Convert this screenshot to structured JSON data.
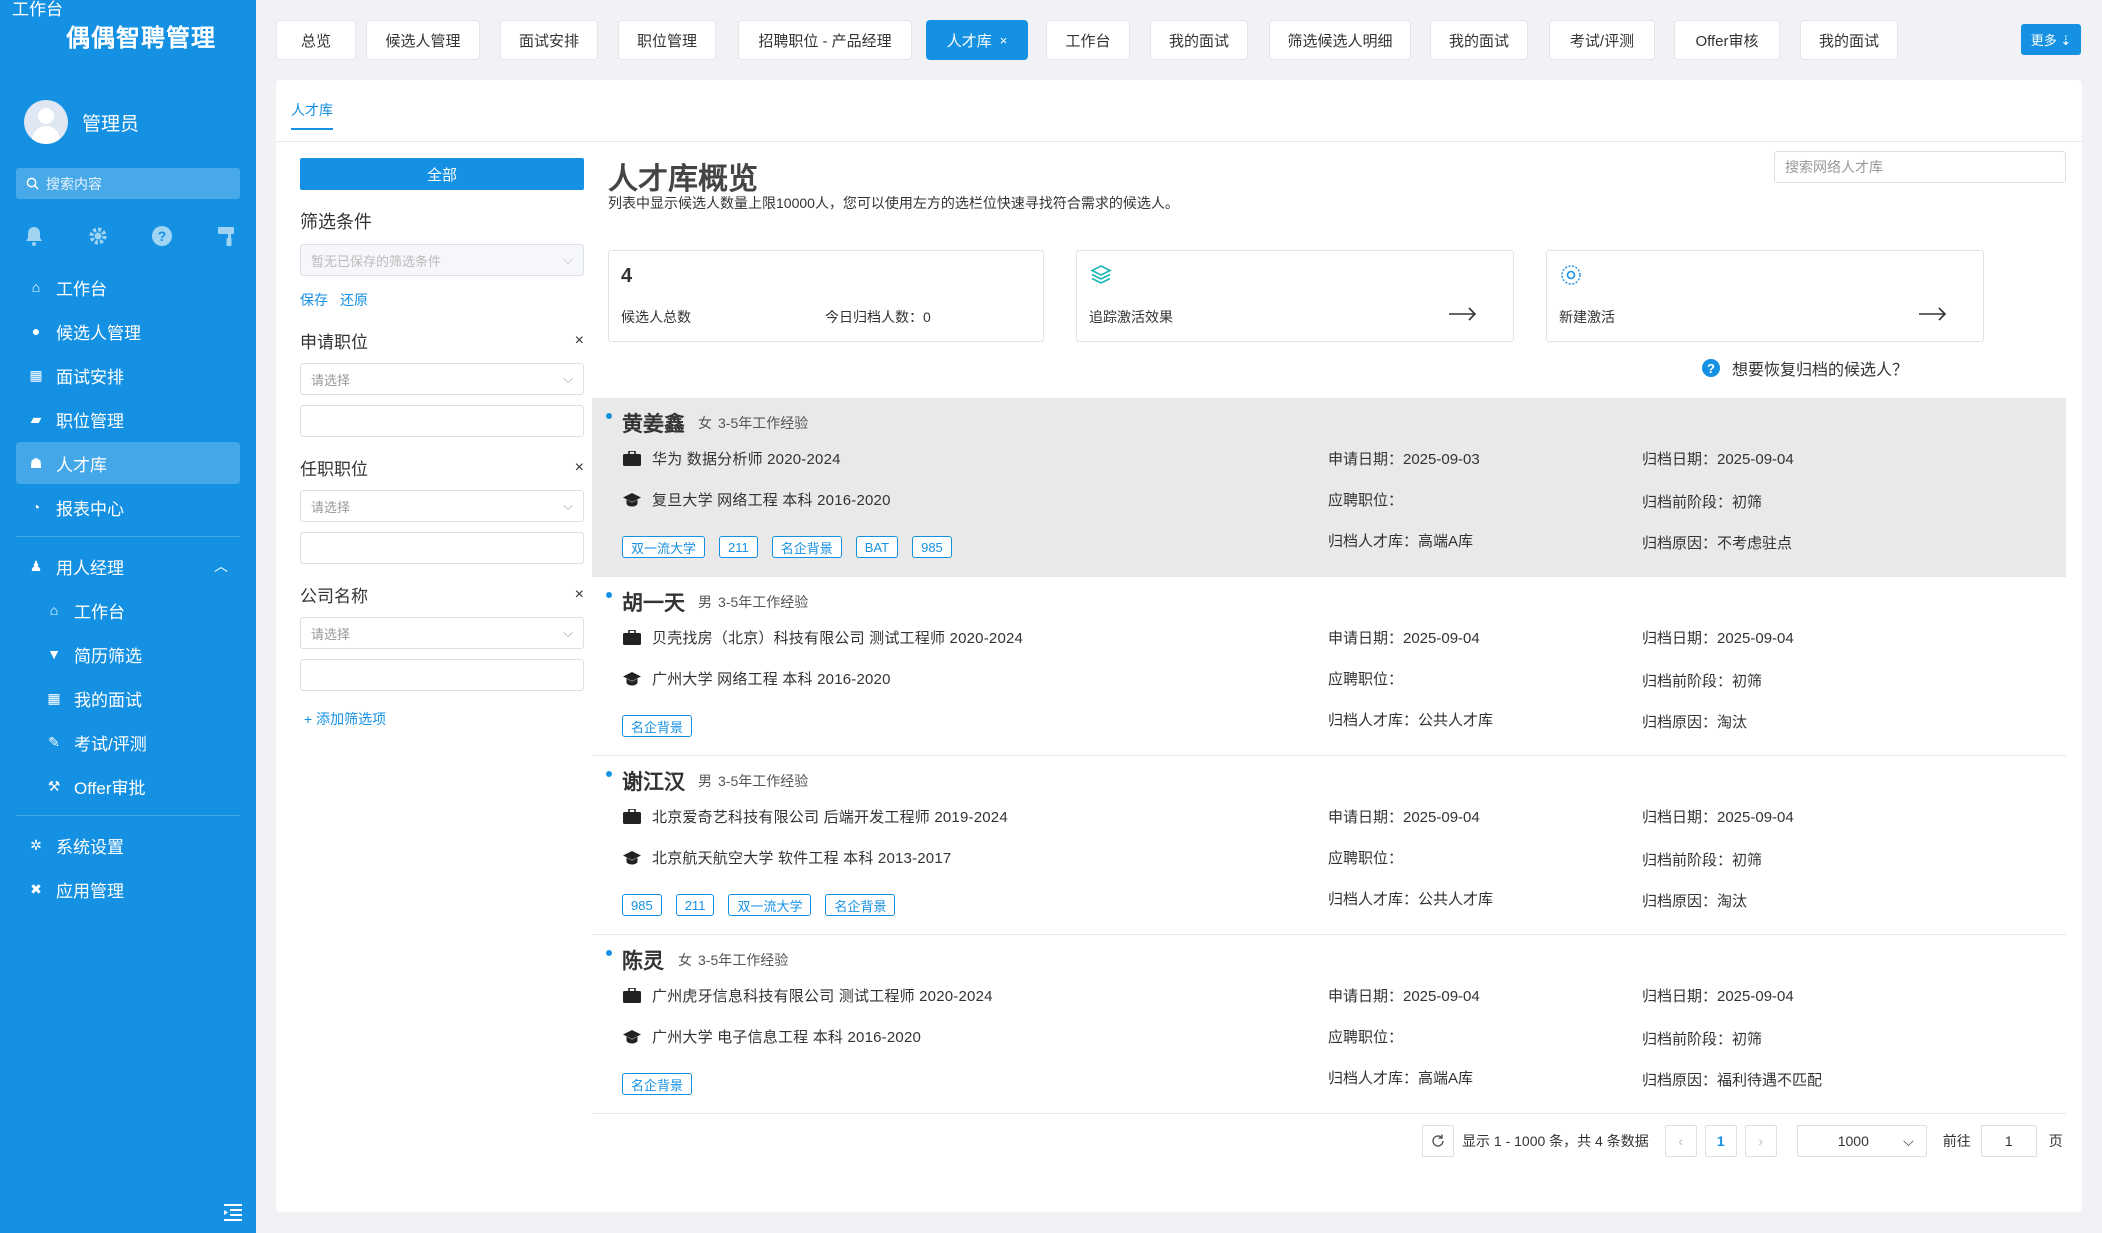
{
  "sidebar": {
    "corner_label": "工作台",
    "logo": "偶偶智聘管理",
    "user_name": "管理员",
    "search_placeholder": "搜索内容",
    "menu": [
      {
        "label": "工作台",
        "icon": "home-icon"
      },
      {
        "label": "候选人管理",
        "icon": "user-icon"
      },
      {
        "label": "面试安排",
        "icon": "calendar-icon"
      },
      {
        "label": "职位管理",
        "icon": "book-icon"
      },
      {
        "label": "人才库",
        "icon": "users-icon",
        "active": true
      },
      {
        "label": "报表中心",
        "icon": "dashboard-icon"
      }
    ],
    "group": {
      "label": "用人经理",
      "icon": "manager-icon"
    },
    "submenu": [
      {
        "label": "工作台",
        "icon": "home-icon"
      },
      {
        "label": "简历筛选",
        "icon": "filter-icon"
      },
      {
        "label": "我的面试",
        "icon": "calendar-icon"
      },
      {
        "label": "考试/评测",
        "icon": "pencil-icon"
      },
      {
        "label": "Offer审批",
        "icon": "gavel-icon"
      }
    ],
    "bottom_menu": [
      {
        "label": "系统设置",
        "icon": "gear-icon"
      },
      {
        "label": "应用管理",
        "icon": "apps-icon"
      }
    ]
  },
  "tabs": [
    {
      "label": "总览"
    },
    {
      "label": "候选人管理"
    },
    {
      "label": "面试安排"
    },
    {
      "label": "职位管理"
    },
    {
      "label": "招聘职位 - 产品经理"
    },
    {
      "label": "人才库",
      "active": true,
      "close": "×"
    },
    {
      "label": "工作台"
    },
    {
      "label": "我的面试"
    },
    {
      "label": "筛选候选人明细"
    },
    {
      "label": "我的面试"
    },
    {
      "label": "考试/评测"
    },
    {
      "label": "Offer审核"
    },
    {
      "label": "我的面试"
    }
  ],
  "more_button": "更多 ⇣",
  "subtab": "人才库",
  "filter": {
    "all_button": "全部",
    "title": "筛选条件",
    "saved_placeholder": "暂无已保存的筛选条件",
    "save": "保存",
    "reset": "还原",
    "groups": [
      {
        "label": "申请职位",
        "placeholder": "请选择"
      },
      {
        "label": "任职职位",
        "placeholder": "请选择"
      },
      {
        "label": "公司名称",
        "placeholder": "请选择"
      }
    ],
    "add_option": "+ 添加筛选项"
  },
  "main": {
    "title": "人才库概览",
    "description": "列表中显示候选人数量上限10000人，您可以使用左方的选栏位快速寻找符合需求的候选人。",
    "search_placeholder": "搜索网络人才库",
    "stats": {
      "total": "4",
      "total_label": "候选人总数",
      "today_label": "今日归档人数：0"
    },
    "track_label": "追踪激活效果",
    "new_label": "新建激活",
    "help_text": "想要恢复归档的候选人？"
  },
  "candidates": [
    {
      "name": "黄姜鑫",
      "gender": "女",
      "experience": "3-5年工作经验",
      "work": "华为  数据分析师  2020-2024",
      "edu": "复旦大学  网络工程  本科  2016-2020",
      "tags": [
        "双一流大学",
        "211",
        "名企背景",
        "BAT",
        "985"
      ],
      "apply_date": "申请日期：2025-09-03",
      "position": "应聘职位：",
      "pool": "归档人才库：高端A库",
      "archive_date": "归档日期：2025-09-04",
      "stage": "归档前阶段：初筛",
      "reason": "归档原因：不考虑驻点",
      "highlight": true
    },
    {
      "name": "胡一天",
      "gender": "男",
      "experience": "3-5年工作经验",
      "work": "贝壳找房（北京）科技有限公司  测试工程师  2020-2024",
      "edu": "广州大学  网络工程  本科  2016-2020",
      "tags": [
        "名企背景"
      ],
      "apply_date": "申请日期：2025-09-04",
      "position": "应聘职位：",
      "pool": "归档人才库：公共人才库",
      "archive_date": "归档日期：2025-09-04",
      "stage": "归档前阶段：初筛",
      "reason": "归档原因：淘汰"
    },
    {
      "name": "谢江汉",
      "gender": "男",
      "experience": "3-5年工作经验",
      "work": "北京爱奇艺科技有限公司  后端开发工程师  2019-2024",
      "edu": "北京航天航空大学  软件工程  本科  2013-2017",
      "tags": [
        "985",
        "211",
        "双一流大学",
        "名企背景"
      ],
      "apply_date": "申请日期：2025-09-04",
      "position": "应聘职位：",
      "pool": "归档人才库：公共人才库",
      "archive_date": "归档日期：2025-09-04",
      "stage": "归档前阶段：初筛",
      "reason": "归档原因：淘汰"
    },
    {
      "name": "陈灵",
      "gender": "女",
      "experience": "3-5年工作经验",
      "work": "广州虎牙信息科技有限公司  测试工程师  2020-2024",
      "edu": "广州大学  电子信息工程  本科  2016-2020",
      "tags": [
        "名企背景"
      ],
      "apply_date": "申请日期：2025-09-04",
      "position": "应聘职位：",
      "pool": "归档人才库：高端A库",
      "archive_date": "归档日期：2025-09-04",
      "stage": "归档前阶段：初筛",
      "reason": "归档原因：福利待遇不匹配"
    }
  ],
  "pagination": {
    "summary": "显示 1 - 1000 条，共 4 条数据",
    "current_page": "1",
    "page_size": "1000",
    "goto_label": "前往",
    "goto_value": "1",
    "page_suffix": "页"
  },
  "colors": {
    "accent": "#1591e3",
    "highlight_row": "#e9e9e9"
  }
}
